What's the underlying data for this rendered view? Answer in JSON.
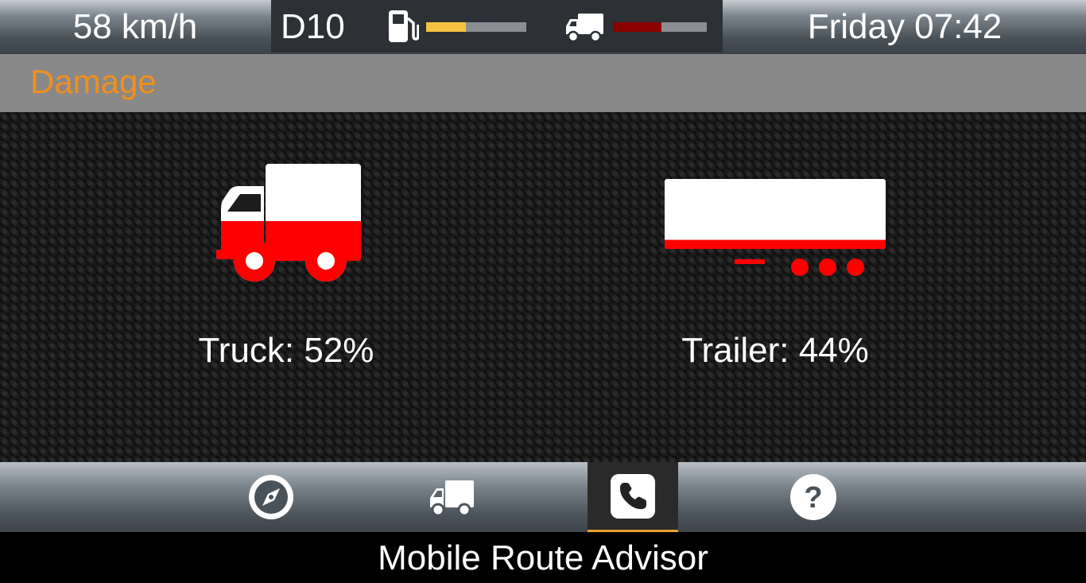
{
  "status_bar": {
    "speed": "58 km/h",
    "gear": "D10",
    "fuel_level": 0.4,
    "fuel_color": "#f5c542",
    "truck_damage_level": 0.52,
    "truck_damage_color": "#8b0000",
    "clock": "Friday 07:42",
    "fuel_icon": "fuel-pump-icon",
    "truck_icon": "truck-icon"
  },
  "page": {
    "title": "Damage",
    "title_color": "#f0901e"
  },
  "damage": {
    "truck": {
      "label": "Truck: 52%",
      "value": 0.52,
      "color": "#ff0000"
    },
    "trailer": {
      "label": "Trailer: 44%",
      "value": 0.13,
      "color": "#ff0000"
    }
  },
  "nav": {
    "items": [
      {
        "icon": "compass-icon",
        "active": false
      },
      {
        "icon": "truck-icon",
        "active": false
      },
      {
        "icon": "phone-icon",
        "active": true
      },
      {
        "icon": "help-icon",
        "active": false
      }
    ],
    "active_color": "#e8a030"
  },
  "footer": {
    "title": "Mobile Route Advisor"
  }
}
